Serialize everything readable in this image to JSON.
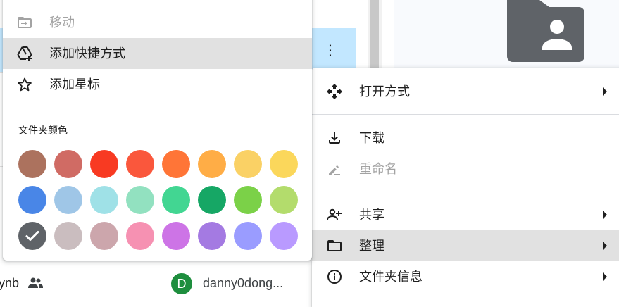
{
  "background": {
    "bottom_row": {
      "name_fragment": "ynb",
      "avatar_letter": "D",
      "owner": "danny0dong..."
    },
    "selected_row_more": "⋮"
  },
  "context_menu": {
    "items": [
      {
        "label": "打开方式",
        "icon": "open-with-icon",
        "has_submenu": true,
        "disabled": false
      },
      {
        "label": "下载",
        "icon": "download-icon",
        "has_submenu": false,
        "disabled": false
      },
      {
        "label": "重命名",
        "icon": "rename-icon",
        "has_submenu": false,
        "disabled": true
      },
      {
        "label": "共享",
        "icon": "person-add-icon",
        "has_submenu": true,
        "disabled": false
      },
      {
        "label": "整理",
        "icon": "folder-open-icon",
        "has_submenu": true,
        "disabled": false,
        "highlighted": true
      },
      {
        "label": "文件夹信息",
        "icon": "info-icon",
        "has_submenu": true,
        "disabled": false
      }
    ]
  },
  "organize_submenu": {
    "items": [
      {
        "label": "移动",
        "icon": "move-icon",
        "disabled": true
      },
      {
        "label": "添加快捷方式",
        "icon": "add-shortcut-icon",
        "disabled": false,
        "highlighted": true
      },
      {
        "label": "添加星标",
        "icon": "star-icon",
        "disabled": false
      }
    ],
    "folder_color_title": "文件夹颜色",
    "folder_colors": [
      [
        "#ac725e",
        "#d06b64",
        "#f83a22",
        "#fa573c",
        "#ff7537",
        "#ffad46",
        "#fad165",
        "#fbd75b"
      ],
      [
        "#4986e7",
        "#9fc6e7",
        "#9fe1e7",
        "#92e1c0",
        "#42d692",
        "#16a765",
        "#7bd148",
        "#b3dc6c"
      ],
      [
        "#5f6368",
        "#cabdbf",
        "#cca6ac",
        "#f691b2",
        "#cd74e6",
        "#a47ae2",
        "#9a9cff",
        "#b99aff"
      ]
    ],
    "selected_color": "#5f6368"
  }
}
